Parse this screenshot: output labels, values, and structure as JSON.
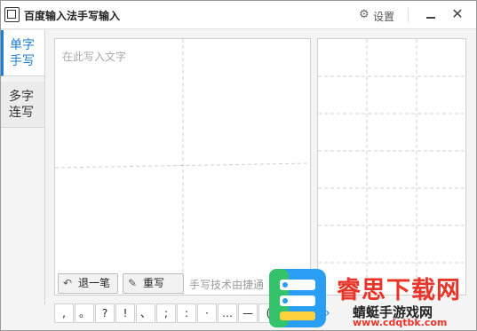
{
  "window": {
    "title": "百度输入法手写输入",
    "settings_label": "设置",
    "minimize_icon": "minimize-icon",
    "close_symbol": "✕"
  },
  "tabs": [
    {
      "label_line1": "单字",
      "label_line2": "手写",
      "active": true
    },
    {
      "label_line1": "多字",
      "label_line2": "连写",
      "active": false
    }
  ],
  "pad": {
    "placeholder": "在此写入文字",
    "undo_label": "退一笔",
    "rewrite_label": "重写",
    "tech_note": "手写技术由捷通"
  },
  "punctuation": [
    ",",
    "。",
    "?",
    "!",
    "、",
    ";",
    ":",
    "·",
    "…",
    "—",
    "("
  ],
  "more_symbol": "›",
  "watermark": {
    "title": "睿思下载网",
    "subtitle": "蜻蜓手游戏网",
    "url": "www.cdqtbk.com"
  },
  "colors": {
    "accent": "#1f7fd0",
    "watermark_red": "#e8352a"
  }
}
